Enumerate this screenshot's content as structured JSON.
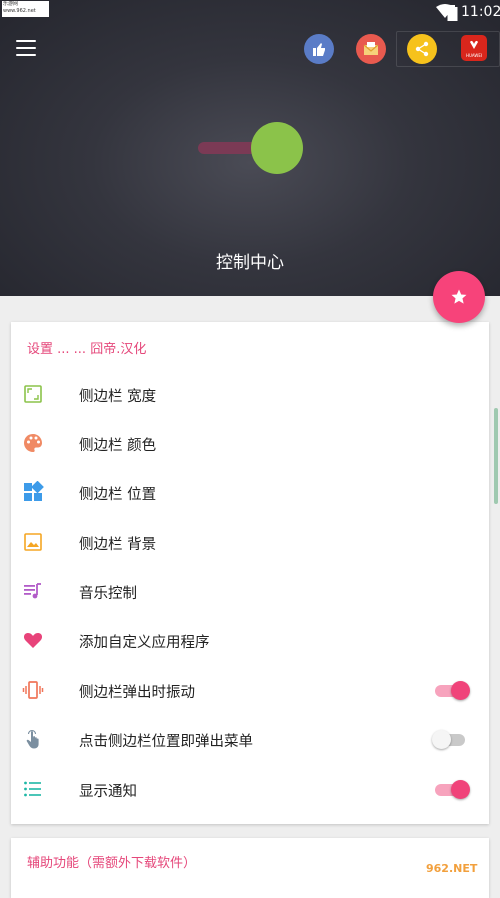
{
  "status_bar": {
    "watermark_line1": "乐游网",
    "watermark_line2": "www.962.net",
    "time": "11:02"
  },
  "header": {
    "title": "控制中心"
  },
  "settings_card": {
    "section_title": "设置 ... ... 囧帝.汉化",
    "items": [
      {
        "label": "侧边栏 宽度",
        "icon": "resize-icon"
      },
      {
        "label": "侧边栏 颜色",
        "icon": "palette-icon"
      },
      {
        "label": "侧边栏 位置",
        "icon": "dashboard-icon"
      },
      {
        "label": "侧边栏 背景",
        "icon": "image-icon"
      },
      {
        "label": "音乐控制",
        "icon": "music-queue-icon"
      },
      {
        "label": "添加自定义应用程序",
        "icon": "heart-icon"
      },
      {
        "label": "侧边栏弹出时振动",
        "icon": "vibration-icon",
        "toggle": true
      },
      {
        "label": "点击侧边栏位置即弹出菜单",
        "icon": "touch-icon",
        "toggle": false
      },
      {
        "label": "显示通知",
        "icon": "list-icon",
        "toggle": true
      }
    ]
  },
  "assist_card": {
    "section_title": "辅助功能（需额外下载软件）"
  },
  "top_icons": [
    {
      "name": "thumbs-up-icon",
      "color": "#5a7cc7"
    },
    {
      "name": "mail-icon",
      "color": "#e85a4f"
    },
    {
      "name": "share-icon",
      "color": "#f6c21c"
    },
    {
      "name": "huawei-icon",
      "color": "#d9261c",
      "text": "HUAWEI"
    }
  ],
  "corner_logo": "962.NET",
  "colors": {
    "accent": "#f0437a",
    "slider_knob": "#8bc34a",
    "header_bg": "#2e2f37"
  }
}
